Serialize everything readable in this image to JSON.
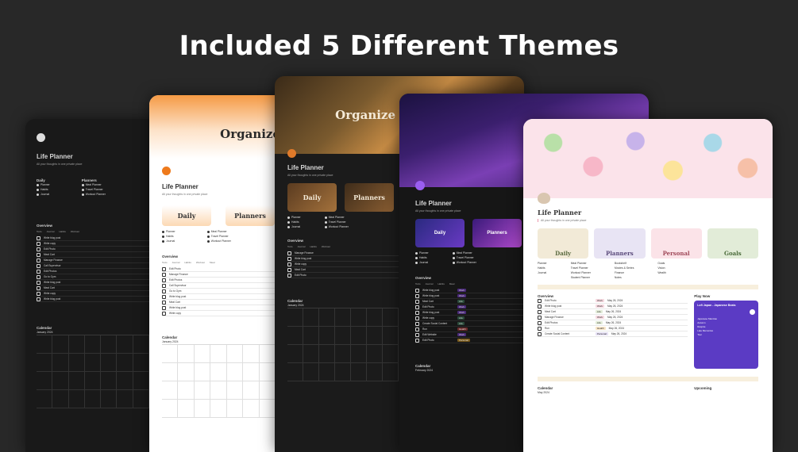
{
  "headline": "Included 5 Different Themes",
  "page": {
    "title": "Life Planner",
    "subtitle": "All your thoughts in one private place",
    "overview": "Overview",
    "calendar": "Calendar",
    "cover_word": "Organize"
  },
  "left_lists": {
    "daily_heading": "Daily",
    "planners_heading": "Planners",
    "daily_items": [
      "Planner",
      "Habits",
      "Journal"
    ],
    "planner_items": [
      "Meal Planner",
      "Travel Planner",
      "Workout Planner"
    ]
  },
  "tabs": [
    "Todo",
    "Journal",
    "Habits",
    "Workout",
    "Meal",
    "Notes"
  ],
  "tasks": [
    "Write blog post",
    "Write copy",
    "Edit Photo",
    "Meal Cart",
    "Manage Finance",
    "Call Supervisor",
    "Edit Photos",
    "Go to Gym",
    "Write blog post",
    "Meal Cart",
    "Write copy",
    "Write blog post",
    "Create Social Content",
    "Run",
    "Edit Website",
    "Edit Photo"
  ],
  "categories": [
    "Work",
    "Work",
    "Life",
    "Life",
    "Work",
    "Work",
    "Life",
    "Health",
    "Work",
    "Personal"
  ],
  "dates": [
    "February 1, 2024",
    "February 3, 2024",
    "January 26, 2024",
    "May 26, 2024"
  ],
  "pink_theme": {
    "buttons": [
      "Daily",
      "Planners",
      "Personal",
      "Goals"
    ],
    "col1": [
      "Planner",
      "Habits",
      "Journal"
    ],
    "col2": [
      "Meal Planner",
      "Travel Planner",
      "Workout Planner",
      "Student Planner"
    ],
    "col3": [
      "Bookshelf",
      "Movies & Series",
      "Finance",
      "Notes"
    ],
    "col4": [
      "Goals",
      "Vision",
      "Wealth"
    ],
    "play_now": "Play Now",
    "song": "Lofi Japan - Japanese Beats",
    "playlist": [
      "Japanese Mantras",
      "Autumn",
      "Respite",
      "Late Memories",
      "Tour"
    ],
    "upcoming": "Upcoming",
    "calendar_month": "May 2024"
  },
  "month_label": "January 2024",
  "month_label_feb": "February 2024",
  "colors": {
    "bg": "#282828",
    "orange": "#f08a33",
    "purple": "#8a4dde",
    "pink_accent": "#e46b8a"
  }
}
